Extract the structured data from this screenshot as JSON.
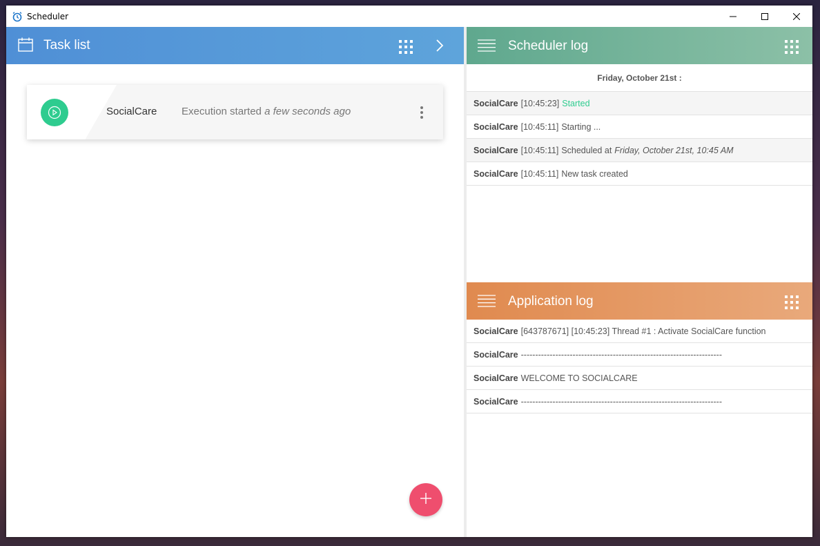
{
  "window": {
    "title": "Scheduler"
  },
  "task_panel": {
    "title": "Task list",
    "tasks": [
      {
        "name": "SocialCare",
        "status_prefix": "Execution started",
        "status_time": "a few seconds ago"
      }
    ]
  },
  "scheduler_log": {
    "title": "Scheduler log",
    "date": "Friday, October 21st :",
    "entries": [
      {
        "source": "SocialCare",
        "time": "[10:45:23]",
        "message": "Started",
        "style": "green"
      },
      {
        "source": "SocialCare",
        "time": "[10:45:11]",
        "message": "Starting ...",
        "style": "normal"
      },
      {
        "source": "SocialCare",
        "time": "[10:45:11]",
        "message": "Scheduled at",
        "detail": "Friday, October 21st, 10:45 AM",
        "style": "italic"
      },
      {
        "source": "SocialCare",
        "time": "[10:45:11]",
        "message": "New task created",
        "style": "normal"
      }
    ]
  },
  "application_log": {
    "title": "Application log",
    "entries": [
      {
        "source": "SocialCare",
        "message": "[643787671] [10:45:23] Thread #1 : Activate SocialCare function"
      },
      {
        "source": "SocialCare",
        "message": "----------------------------------------------------------------------"
      },
      {
        "source": "SocialCare",
        "message": "WELCOME TO SOCIALCARE"
      },
      {
        "source": "SocialCare",
        "message": "----------------------------------------------------------------------"
      }
    ]
  },
  "colors": {
    "task_header": "#4f8fd6",
    "scheduler_header": "#5fa88e",
    "application_header": "#e08a4f",
    "started_green": "#2ecc8f",
    "fab": "#ef4e6e"
  },
  "icons": {
    "app": "alarm-clock-icon",
    "task_header": "calendar-icon",
    "grid": "grid-icon",
    "next": "chevron-right-icon",
    "menu": "hamburger-icon",
    "play": "play-icon",
    "more": "kebab-icon",
    "add": "plus-icon"
  }
}
